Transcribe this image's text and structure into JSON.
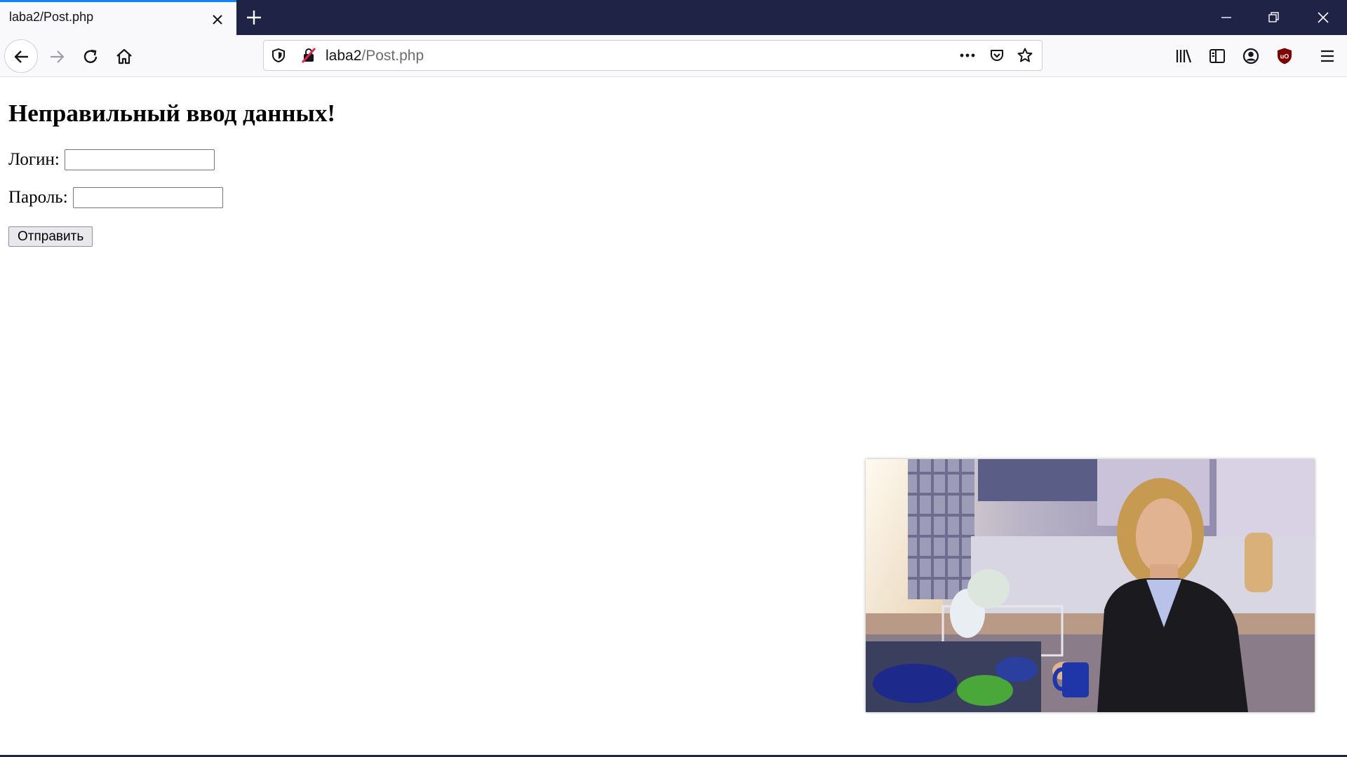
{
  "tab": {
    "title": "laba2/Post.php"
  },
  "urlbar": {
    "host": "laba2",
    "path": "/Post.php"
  },
  "page": {
    "heading": "Неправильный ввод данных!",
    "login_label": "Логин:",
    "login_value": "",
    "password_label": "Пароль:",
    "password_value": "",
    "submit_label": "Отправить"
  },
  "icons": {
    "tab_close": "close-icon",
    "new_tab": "plus-icon",
    "minimize": "minimize-icon",
    "restore": "restore-icon",
    "close_window": "close-icon",
    "back": "arrow-left-icon",
    "forward": "arrow-right-icon",
    "reload": "reload-icon",
    "home": "home-icon",
    "tracking_protection": "shield-icon",
    "insecure": "insecure-lock-icon",
    "page_actions": "more-horizontal-icon",
    "pocket": "pocket-icon",
    "bookmark": "star-icon",
    "library": "library-icon",
    "sidebar": "sidebar-icon",
    "account": "account-icon",
    "ublock": "ublock-origin-icon",
    "menu": "hamburger-menu-icon"
  },
  "colors": {
    "tabbar_bg": "#1f2346",
    "active_tab_accent": "#0a84ff",
    "toolbar_bg": "#f9f9fb",
    "ublock_red": "#800000"
  },
  "pip_video": {
    "description_icon": "video-frame"
  }
}
